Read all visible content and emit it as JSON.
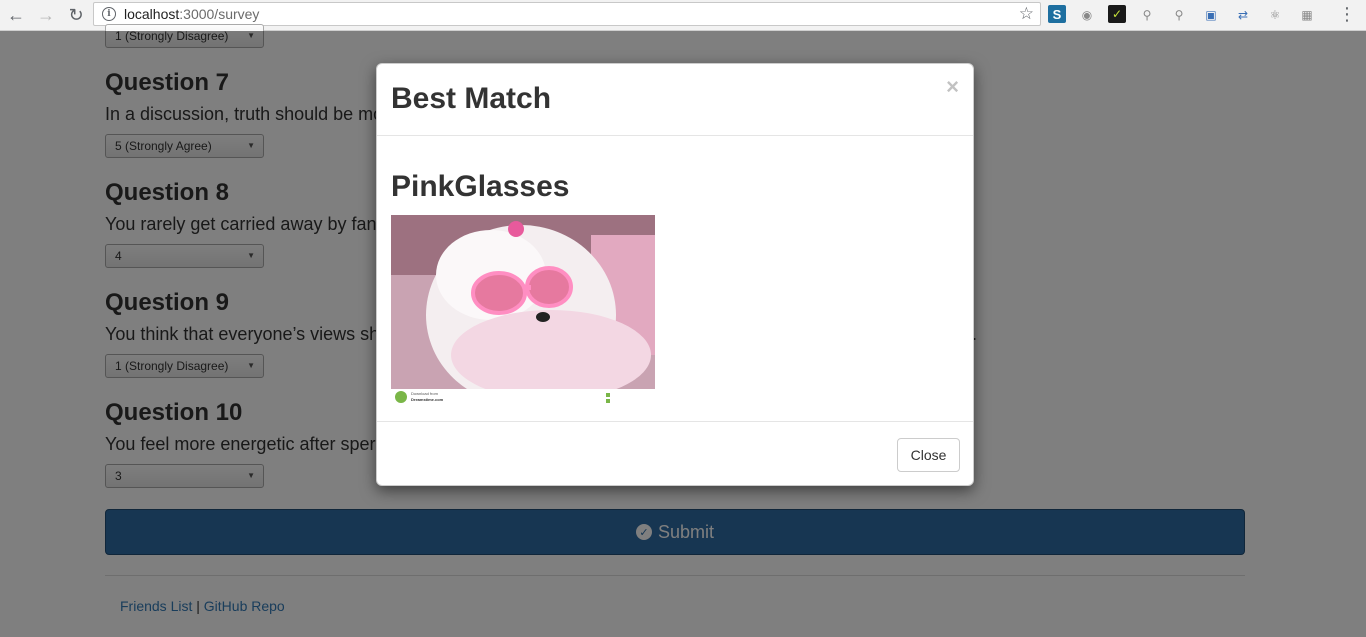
{
  "browser": {
    "url_host": "localhost",
    "url_path": ":3000/survey",
    "menu_glyph": "⋮"
  },
  "icons": {
    "back": "back-arrow-icon",
    "forward": "forward-arrow-icon",
    "reload": "reload-icon",
    "info": "info-icon",
    "star": "star-icon",
    "extensions": [
      "s-extension-icon",
      "ghost-extension-icon",
      "check-extension-icon",
      "zoom-extension-icon",
      "zoom-out-extension-icon",
      "screen-capture-icon",
      "arrows-extension-icon",
      "react-icon",
      "grid-extension-icon"
    ]
  },
  "survey": {
    "q6_select": "1 (Strongly Disagree)",
    "questions": [
      {
        "title": "Question 7",
        "text": "In a discussion, truth should be mo",
        "answer": "5 (Strongly Agree)"
      },
      {
        "title": "Question 8",
        "text": "You rarely get carried away by fan",
        "answer": "4"
      },
      {
        "title": "Question 9",
        "text": "You think that everyone’s views sh",
        "text_tail": ".",
        "answer": "1 (Strongly Disagree)"
      },
      {
        "title": "Question 10",
        "text": "You feel more energetic after sper",
        "answer": "3"
      }
    ],
    "submit_label": "Submit"
  },
  "footer": {
    "friends_link": "Friends List",
    "separator": "|",
    "github_link": "GitHub Repo"
  },
  "modal": {
    "title": "Best Match",
    "close_x": "×",
    "match_name": "PinkGlasses",
    "close_button": "Close",
    "photo_watermark_line1": "Download from",
    "photo_watermark_line2": "Dreamstime.com"
  },
  "colors": {
    "primary": "#2e6da4",
    "link": "#337ab7"
  }
}
